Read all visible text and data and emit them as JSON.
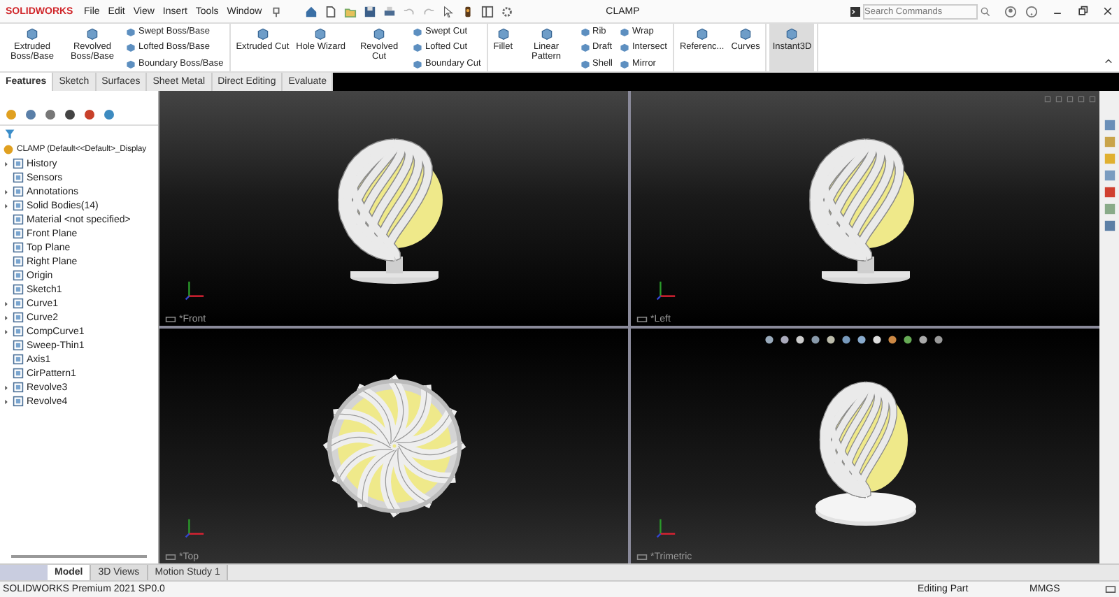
{
  "title_bar": {
    "logo": "SOLIDWORKS",
    "menu": [
      "File",
      "Edit",
      "View",
      "Insert",
      "Tools",
      "Window"
    ],
    "document": "CLAMP",
    "search": {
      "placeholder": "Search Commands"
    }
  },
  "ribbon": {
    "groups": [
      {
        "items": [
          {
            "kind": "large",
            "label": "Extruded Boss/Base",
            "on": false
          },
          {
            "kind": "large",
            "label": "Revolved Boss/Base",
            "on": false
          },
          {
            "kind": "stack",
            "labels": [
              "Swept Boss/Base",
              "Lofted Boss/Base",
              "Boundary Boss/Base"
            ]
          }
        ]
      },
      {
        "items": [
          {
            "kind": "large",
            "label": "Extruded Cut",
            "on": false
          },
          {
            "kind": "large",
            "label": "Hole Wizard",
            "on": false
          },
          {
            "kind": "large",
            "label": "Revolved Cut",
            "on": false
          },
          {
            "kind": "stack",
            "labels": [
              "Swept Cut",
              "Lofted Cut",
              "Boundary Cut"
            ]
          }
        ]
      },
      {
        "items": [
          {
            "kind": "large",
            "label": "Fillet",
            "on": false
          },
          {
            "kind": "large",
            "label": "Linear Pattern",
            "on": false
          },
          {
            "kind": "stack",
            "labels": [
              "Rib",
              "Draft",
              "Shell"
            ]
          },
          {
            "kind": "stack",
            "labels": [
              "Wrap",
              "Intersect",
              "Mirror"
            ]
          }
        ]
      },
      {
        "items": [
          {
            "kind": "large",
            "label": "Referenc...",
            "on": false
          },
          {
            "kind": "large",
            "label": "Curves",
            "on": false
          }
        ]
      },
      {
        "items": [
          {
            "kind": "large",
            "label": "Instant3D",
            "on": true
          }
        ]
      }
    ]
  },
  "command_tabs": [
    {
      "label": "Features",
      "selected": true
    },
    {
      "label": "Sketch",
      "selected": false
    },
    {
      "label": "Surfaces",
      "selected": false
    },
    {
      "label": "Sheet Metal",
      "selected": false
    },
    {
      "label": "Direct Editing",
      "selected": false
    },
    {
      "label": "Evaluate",
      "selected": false
    }
  ],
  "feature_tree": {
    "root": "CLAMP  (Default<<Default>_Display",
    "items": [
      {
        "label": "History",
        "expandable": true
      },
      {
        "label": "Sensors",
        "expandable": false
      },
      {
        "label": "Annotations",
        "expandable": true
      },
      {
        "label": "Solid Bodies(14)",
        "expandable": true
      },
      {
        "label": "Material <not specified>",
        "expandable": false
      },
      {
        "label": "Front Plane",
        "expandable": false
      },
      {
        "label": "Top Plane",
        "expandable": false
      },
      {
        "label": "Right Plane",
        "expandable": false
      },
      {
        "label": "Origin",
        "expandable": false
      },
      {
        "label": "Sketch1",
        "expandable": false
      },
      {
        "label": "Curve1",
        "expandable": true
      },
      {
        "label": "Curve2",
        "expandable": true
      },
      {
        "label": "CompCurve1",
        "expandable": true
      },
      {
        "label": "Sweep-Thin1",
        "expandable": false
      },
      {
        "label": "Axis1",
        "expandable": false
      },
      {
        "label": "CirPattern1",
        "expandable": false
      },
      {
        "label": "Revolve3",
        "expandable": true
      },
      {
        "label": "Revolve4",
        "expandable": true
      }
    ]
  },
  "viewports": [
    {
      "label": "*Front",
      "kind": "front"
    },
    {
      "label": "*Left",
      "kind": "front"
    },
    {
      "label": "*Top",
      "kind": "top"
    },
    {
      "label": "*Trimetric",
      "kind": "iso"
    }
  ],
  "bottom_tabs": [
    {
      "label": "Model",
      "selected": true
    },
    {
      "label": "3D Views",
      "selected": false
    },
    {
      "label": "Motion Study 1",
      "selected": false
    }
  ],
  "status_bar": {
    "product": "SOLIDWORKS Premium 2021 SP0.0",
    "mode": "Editing Part",
    "units": "MMGS"
  }
}
